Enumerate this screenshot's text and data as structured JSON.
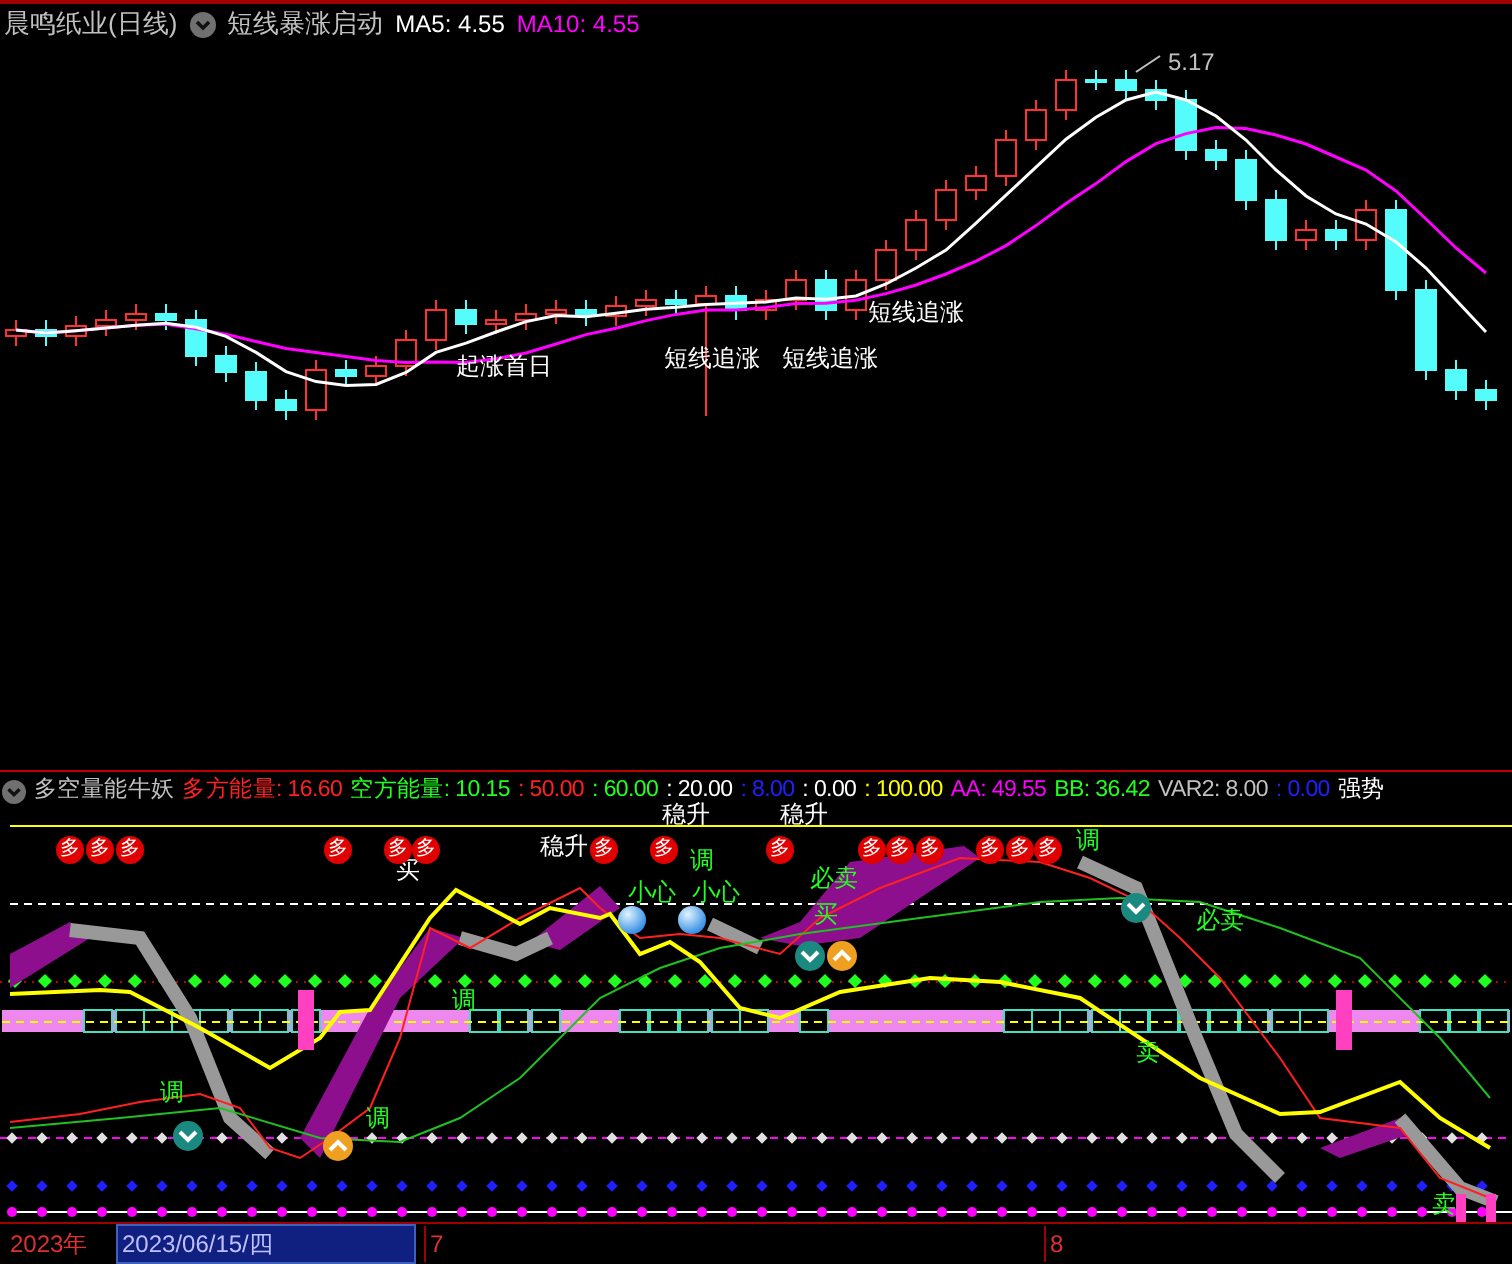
{
  "chart_header": {
    "title": "晨鸣纸业(日线)",
    "indicator": "短线暴涨启动",
    "legend": [
      {
        "label": "MA5: 4.55",
        "color": "#ffffff"
      },
      {
        "label": "MA10: 4.55",
        "color": "#ff00ff"
      }
    ]
  },
  "price_chart": {
    "high_label": "5.17",
    "signals": [
      {
        "text": "起涨首日"
      },
      {
        "text": "短线追涨"
      },
      {
        "text": "短线追涨"
      },
      {
        "text": "短线追涨"
      }
    ]
  },
  "indicator_header": {
    "title": "多空量能牛妖",
    "values": [
      {
        "label": "多方能量: 16.60",
        "color": "#ff2020"
      },
      {
        "label": "空方能量: 10.15",
        "color": "#20ff20"
      },
      {
        "label": ": 50.00",
        "color": "#ff2020"
      },
      {
        "label": ": 60.00",
        "color": "#20ff20"
      },
      {
        "label": ": 20.00",
        "color": "#ffffff"
      },
      {
        "label": ": 8.00",
        "color": "#2020ff"
      },
      {
        "label": ": 0.00",
        "color": "#ffffff"
      },
      {
        "label": ": 100.00",
        "color": "#ffff00"
      },
      {
        "label": "AA: 49.55",
        "color": "#ff00ff"
      },
      {
        "label": "BB: 36.42",
        "color": "#20ff20"
      },
      {
        "label": "VAR2: 8.00",
        "color": "#c0c0c0"
      },
      {
        "label": ": 0.00",
        "color": "#2020ff"
      },
      {
        "label": "强势",
        "color": "#ffffff"
      }
    ]
  },
  "indicator_chart": {
    "markers": [
      {
        "kind": "badge",
        "text": "多"
      },
      {
        "kind": "badge",
        "text": "多"
      },
      {
        "kind": "badge",
        "text": "多"
      },
      {
        "kind": "label",
        "text": "调",
        "color": "#20ff20"
      },
      {
        "kind": "badge",
        "text": "多"
      },
      {
        "kind": "label",
        "text": "调",
        "color": "#20ff20"
      },
      {
        "kind": "label",
        "text": "买",
        "color": "#ffffff"
      },
      {
        "kind": "badge",
        "text": "多"
      },
      {
        "kind": "badge",
        "text": "多"
      },
      {
        "kind": "label",
        "text": "调",
        "color": "#20ff20"
      },
      {
        "kind": "label",
        "text": "稳升",
        "color": "#ffffff"
      },
      {
        "kind": "badge",
        "text": "多"
      },
      {
        "kind": "label",
        "text": "小心",
        "color": "#20ff20"
      },
      {
        "kind": "label",
        "text": "稳升",
        "color": "#ffffff"
      },
      {
        "kind": "badge",
        "text": "多"
      },
      {
        "kind": "label",
        "text": "调",
        "color": "#20ff20"
      },
      {
        "kind": "label",
        "text": "小心",
        "color": "#20ff20"
      },
      {
        "kind": "label",
        "text": "稳升",
        "color": "#ffffff"
      },
      {
        "kind": "badge",
        "text": "多"
      },
      {
        "kind": "label",
        "text": "必卖",
        "color": "#20ff20"
      },
      {
        "kind": "label",
        "text": "买",
        "color": "#20ff20"
      },
      {
        "kind": "badge",
        "text": "多"
      },
      {
        "kind": "badge",
        "text": "多"
      },
      {
        "kind": "badge",
        "text": "多"
      },
      {
        "kind": "badge",
        "text": "多"
      },
      {
        "kind": "badge",
        "text": "多"
      },
      {
        "kind": "badge",
        "text": "多"
      },
      {
        "kind": "label",
        "text": "调",
        "color": "#20ff20"
      },
      {
        "kind": "label",
        "text": "卖",
        "color": "#20ff20"
      },
      {
        "kind": "label",
        "text": "必卖",
        "color": "#20ff20"
      },
      {
        "kind": "label",
        "text": "卖",
        "color": "#20ff20"
      }
    ]
  },
  "time_axis": {
    "year": "2023年",
    "cursor_date": "2023/06/15/四",
    "months": [
      "7",
      "8"
    ]
  }
}
